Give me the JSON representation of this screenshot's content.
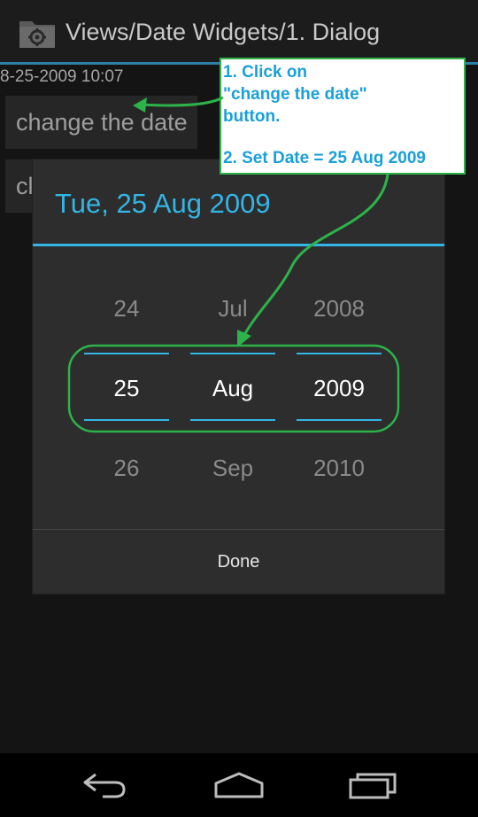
{
  "app": {
    "title": "Views/Date Widgets/1. Dialog",
    "date_readout": "8-25-2009 10:07",
    "buttons": {
      "change_date": "change the date",
      "change_time_partial": "cl"
    }
  },
  "dialog": {
    "title": "Tue, 25 Aug 2009",
    "day": {
      "prev": "24",
      "current": "25",
      "next": "26"
    },
    "month": {
      "prev": "Jul",
      "current": "Aug",
      "next": "Sep"
    },
    "year": {
      "prev": "2008",
      "current": "2009",
      "next": "2010"
    },
    "done_label": "Done"
  },
  "annotation": {
    "line1": "1. Click on",
    "line2": "\"change the date\"",
    "line3": "button.",
    "line4": "2. Set Date = 25 Aug 2009"
  },
  "colors": {
    "accent": "#33b5e5",
    "annotation_green": "#2db34a",
    "annotation_text": "#1aa0d8",
    "dialog_bg": "#2d2d2d"
  },
  "icons": {
    "app_icon": "settings-folder-icon",
    "back": "back-icon",
    "home": "home-icon",
    "recents": "recent-apps-icon"
  }
}
